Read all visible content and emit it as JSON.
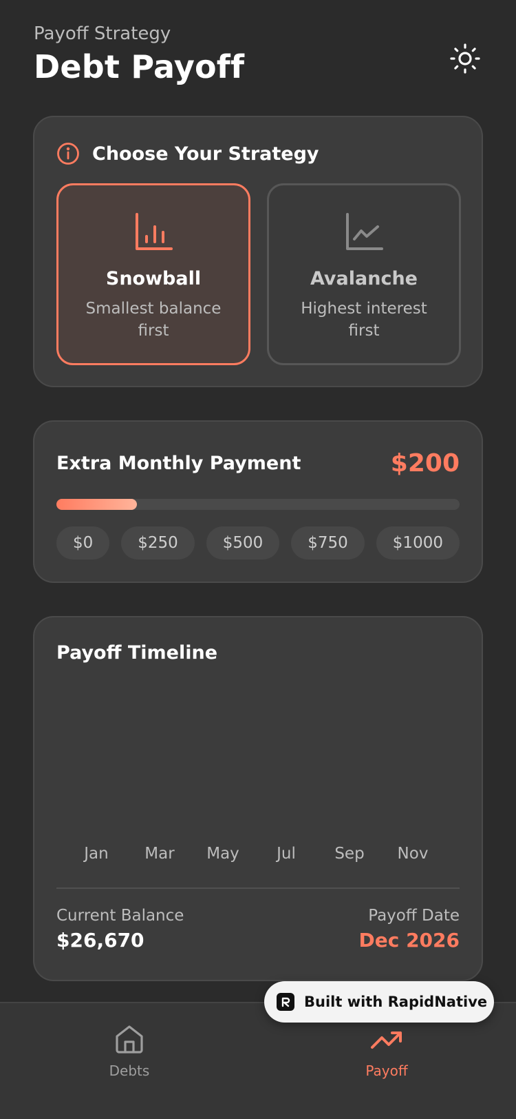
{
  "header": {
    "subtitle": "Payoff Strategy",
    "title": "Debt Payoff",
    "theme_icon": "sun-icon"
  },
  "strategy": {
    "title": "Choose Your Strategy",
    "options": [
      {
        "name": "Snowball",
        "description": "Smallest balance first",
        "icon": "bar-chart-icon",
        "selected": true
      },
      {
        "name": "Avalanche",
        "description": "Highest interest first",
        "icon": "line-chart-icon",
        "selected": false
      }
    ]
  },
  "extra_payment": {
    "label": "Extra Monthly Payment",
    "value": "$200",
    "slider_fraction": 0.2,
    "presets": [
      "$0",
      "$250",
      "$500",
      "$750",
      "$1000"
    ]
  },
  "timeline": {
    "title": "Payoff Timeline",
    "months": [
      "Jan",
      "Mar",
      "May",
      "Jul",
      "Sep",
      "Nov"
    ],
    "current_balance_label": "Current Balance",
    "current_balance": "$26,670",
    "payoff_date_label": "Payoff Date",
    "payoff_date": "Dec 2026"
  },
  "nav": {
    "items": [
      {
        "label": "Debts",
        "icon": "home-icon",
        "active": false
      },
      {
        "label": "Payoff",
        "icon": "trending-up-icon",
        "active": true
      }
    ]
  },
  "badge": {
    "text": "Built with RapidNative"
  },
  "colors": {
    "accent": "#ff7c60",
    "background": "#2b2b2b",
    "card": "#3c3c3c"
  }
}
